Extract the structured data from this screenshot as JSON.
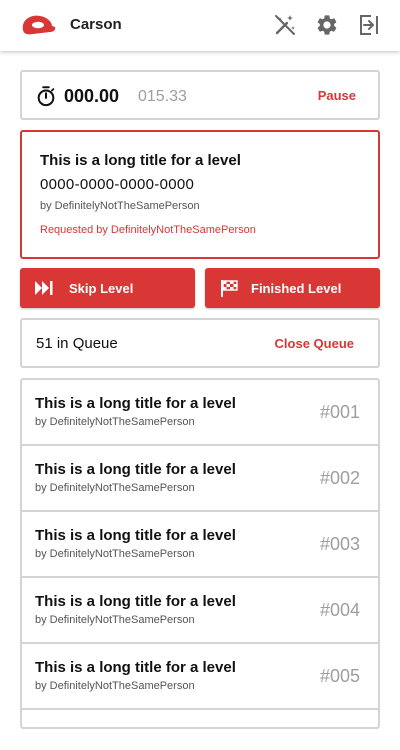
{
  "app": {
    "name": "Carson",
    "brand_color": "#d93636",
    "logo_icon": "cap-logo-icon"
  },
  "header": {
    "icons": [
      "magic-wand-off-icon",
      "gear-icon",
      "exit-icon"
    ]
  },
  "timer": {
    "icon": "stopwatch-icon",
    "current": "000.00",
    "total": "015.33",
    "pause_label": "Pause"
  },
  "current_level": {
    "title": "This is a long title for a level",
    "code": "0000-0000-0000-0000",
    "author": "by DefinitelyNotTheSamePerson",
    "requested_by": "Requested by DefinitelyNotTheSamePerson"
  },
  "actions": {
    "skip_label": "Skip Level",
    "skip_icon": "skip-forward-icon",
    "finish_label": "Finished Level",
    "finish_icon": "checkered-flag-icon"
  },
  "queue": {
    "count_label": "51 in Queue",
    "close_label": "Close Queue",
    "items": [
      {
        "title": "This is a long title for a level",
        "author": "by DefinitelyNotTheSamePerson",
        "number": "#001"
      },
      {
        "title": "This is a long title for a level",
        "author": "by DefinitelyNotTheSamePerson",
        "number": "#002"
      },
      {
        "title": "This is a long title for a level",
        "author": "by DefinitelyNotTheSamePerson",
        "number": "#003"
      },
      {
        "title": "This is a long title for a level",
        "author": "by DefinitelyNotTheSamePerson",
        "number": "#004"
      },
      {
        "title": "This is a long title for a level",
        "author": "by DefinitelyNotTheSamePerson",
        "number": "#005"
      }
    ]
  }
}
